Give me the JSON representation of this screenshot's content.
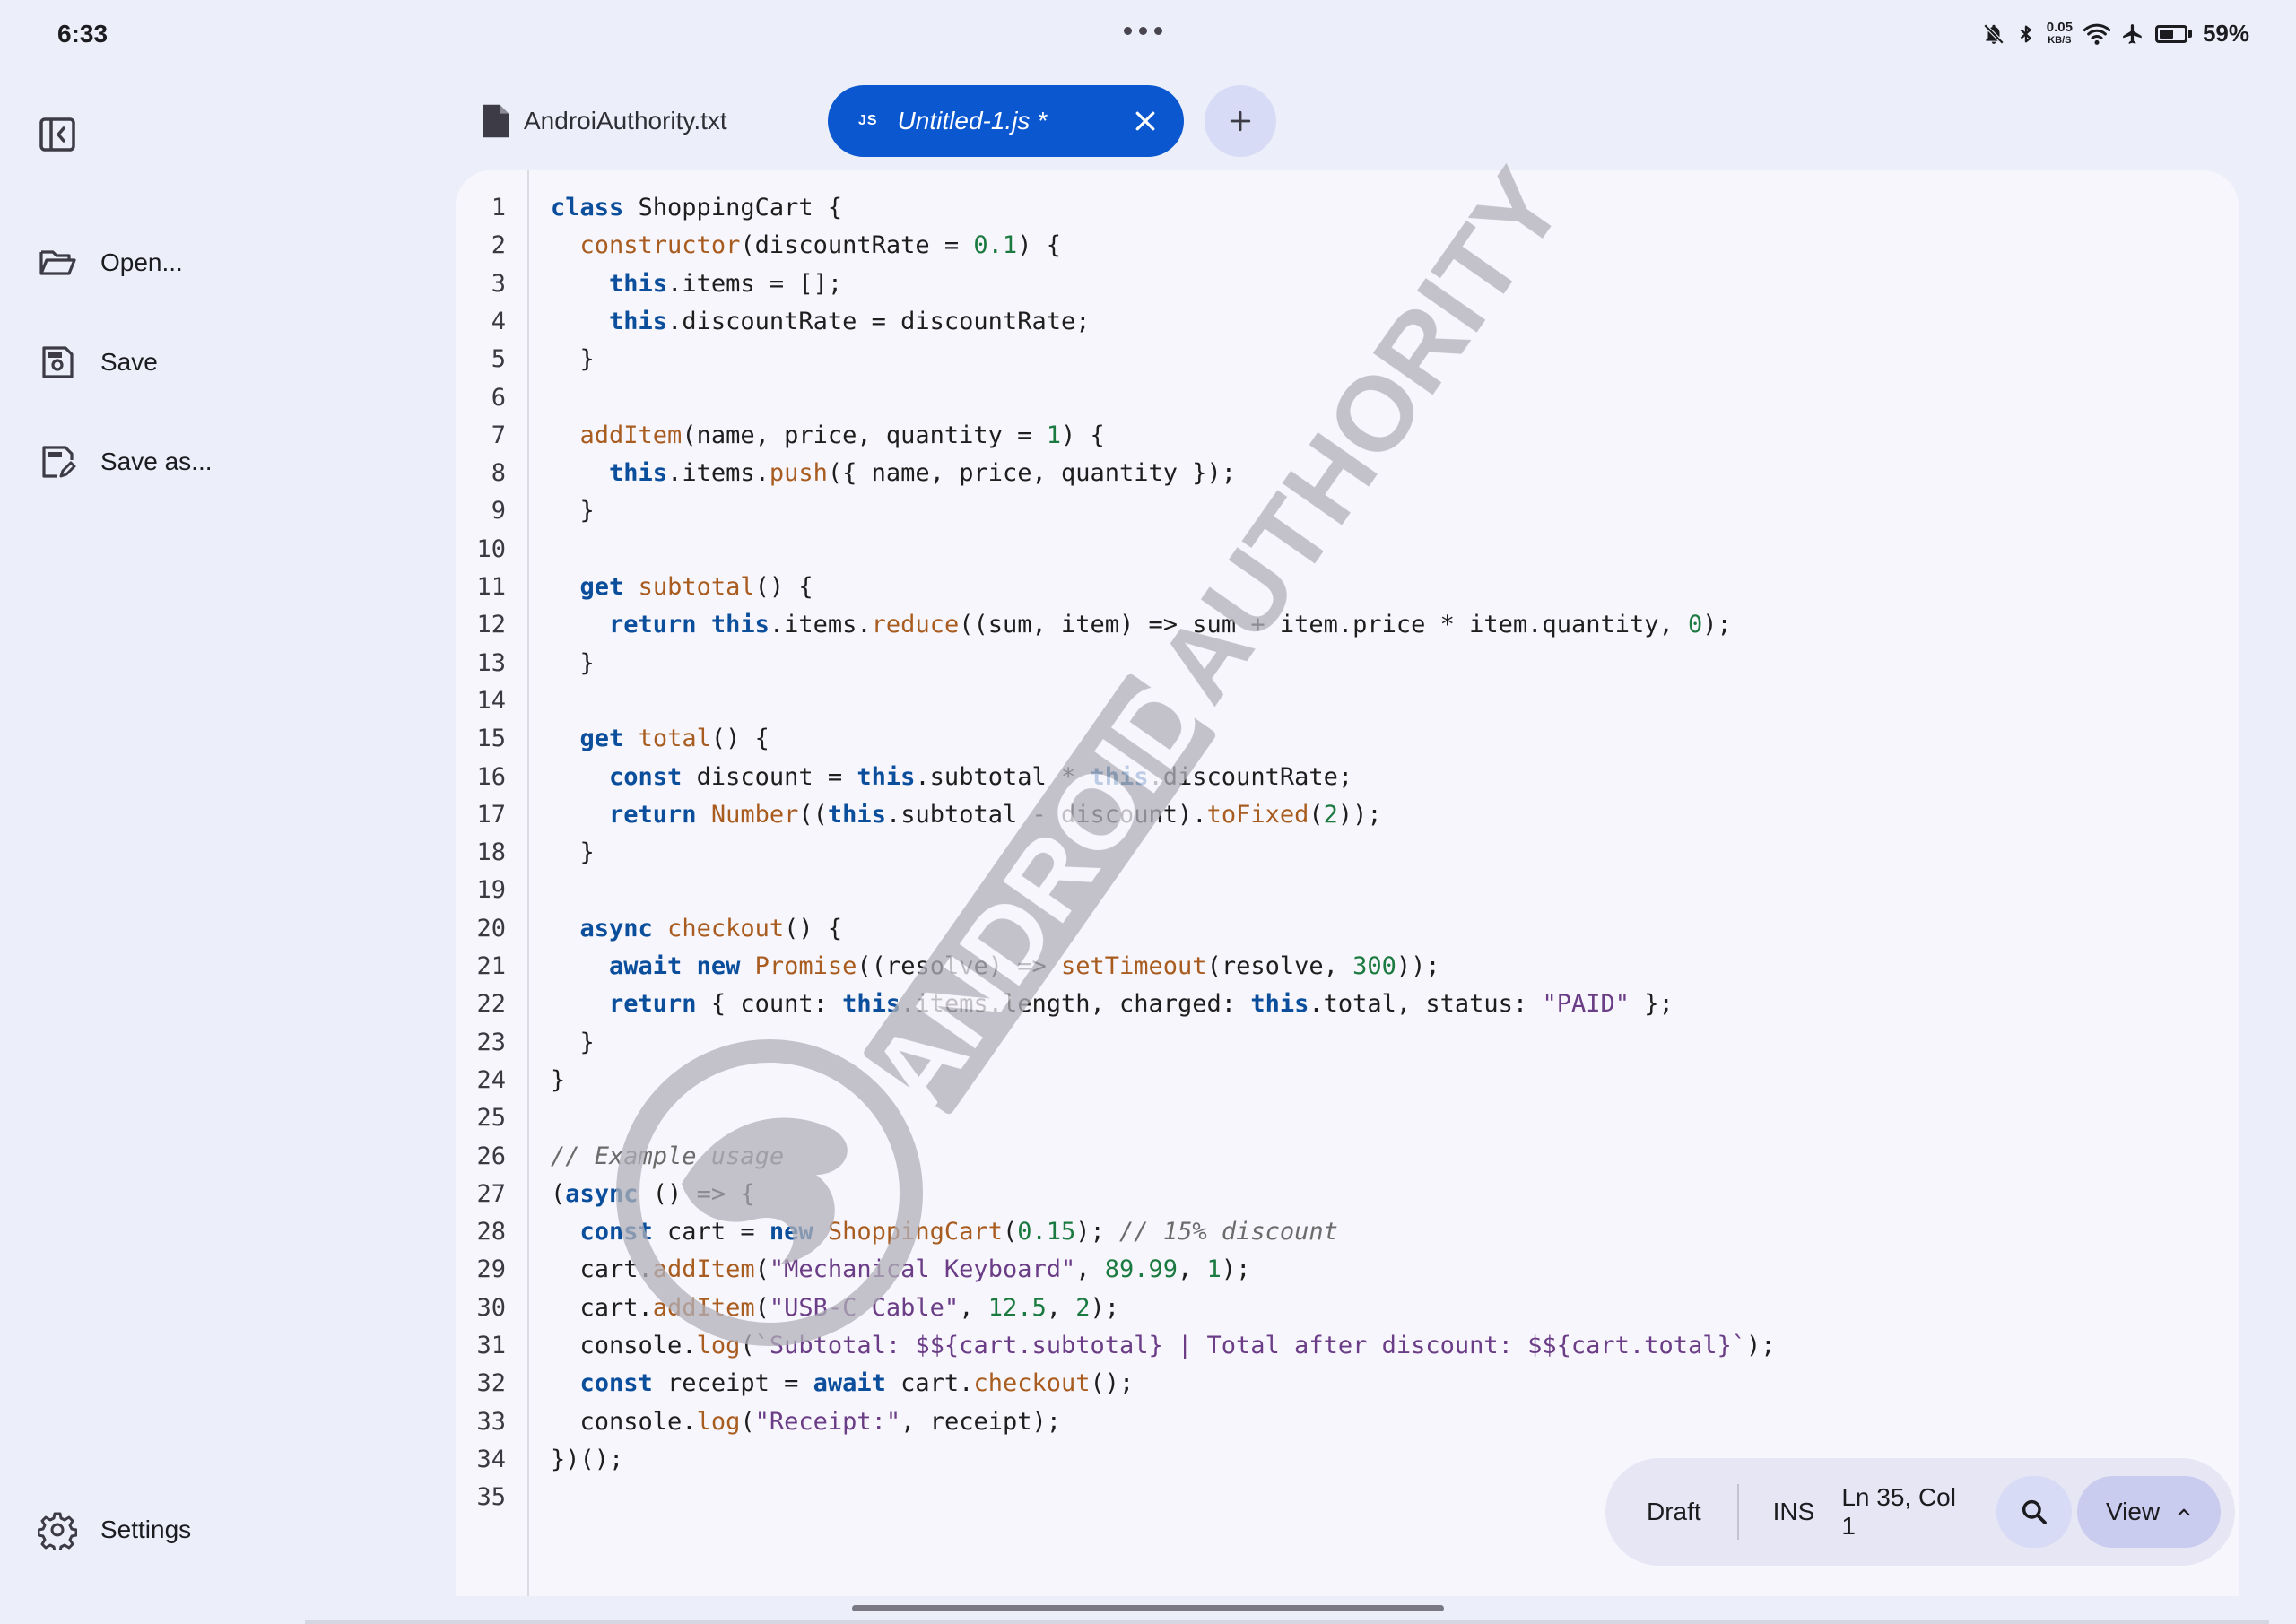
{
  "status_bar": {
    "time": "6:33",
    "net_speed_value": "0.05",
    "net_speed_unit": "KB/S",
    "battery": "59%",
    "battery_level": 0.59,
    "icons": [
      "bell-off-icon",
      "bluetooth-icon",
      "wifi-icon",
      "airplane-icon",
      "battery-icon"
    ]
  },
  "sidebar": {
    "toggle_icon": "sidebar-collapse-icon",
    "items": [
      {
        "label": "Open...",
        "icon": "folder-open-icon"
      },
      {
        "label": "Save",
        "icon": "save-icon"
      },
      {
        "label": "Save as...",
        "icon": "save-as-icon"
      }
    ],
    "settings_label": "Settings",
    "settings_icon": "gear-icon"
  },
  "tabs": [
    {
      "label": "AndroiAuthority.txt",
      "icon": "file-icon",
      "active": false
    },
    {
      "label": "Untitled-1.js *",
      "badge": "JS",
      "active": true,
      "close_icon": "close-icon"
    }
  ],
  "new_tab_icon": "plus-icon",
  "editor": {
    "line_numbers": [
      "1",
      "2",
      "3",
      "4",
      "5",
      "6",
      "7",
      "8",
      "9",
      "10",
      "11",
      "12",
      "13",
      "14",
      "15",
      "16",
      "17",
      "18",
      "19",
      "20",
      "21",
      "22",
      "23",
      "24",
      "25",
      "26",
      "27",
      "28",
      "29",
      "30",
      "31",
      "32",
      "33",
      "34",
      "35"
    ],
    "lines": [
      "class ShoppingCart {",
      "  constructor(discountRate = 0.1) {",
      "    this.items = [];",
      "    this.discountRate = discountRate;",
      "  }",
      "",
      "  addItem(name, price, quantity = 1) {",
      "    this.items.push({ name, price, quantity });",
      "  }",
      "",
      "  get subtotal() {",
      "    return this.items.reduce((sum, item) => sum + item.price * item.quantity, 0);",
      "  }",
      "",
      "  get total() {",
      "    const discount = this.subtotal * this.discountRate;",
      "    return Number((this.subtotal - discount).toFixed(2));",
      "  }",
      "",
      "  async checkout() {",
      "    await new Promise((resolve) => setTimeout(resolve, 300));",
      "    return { count: this.items.length, charged: this.total, status: \"PAID\" };",
      "  }",
      "}",
      "",
      "// Example usage",
      "(async () => {",
      "  const cart = new ShoppingCart(0.15); // 15% discount",
      "  cart.addItem(\"Mechanical Keyboard\", 89.99, 1);",
      "  cart.addItem(\"USB-C Cable\", 12.5, 2);",
      "  console.log(`Subtotal: $${cart.subtotal} | Total after discount: $${cart.total}`);",
      "  const receipt = await cart.checkout();",
      "  console.log(\"Receipt:\", receipt);",
      "})();",
      ""
    ]
  },
  "watermark": {
    "text": "ANDROID AUTHORITY"
  },
  "status_pill": {
    "draft_label": "Draft",
    "mode": "INS",
    "cursor_position": "Ln 35, Col 1",
    "search_icon": "search-icon",
    "view_label": "View",
    "view_icon": "chevron-up-icon"
  },
  "colors": {
    "background": "#eceffa",
    "accent": "#0b57d0",
    "editor_bg": "#f8f6fd",
    "keyword": "#0b4f9c",
    "function": "#a85c1f",
    "number": "#1b7a3f",
    "string": "#6a3d86",
    "comment": "#6b6b6b"
  }
}
